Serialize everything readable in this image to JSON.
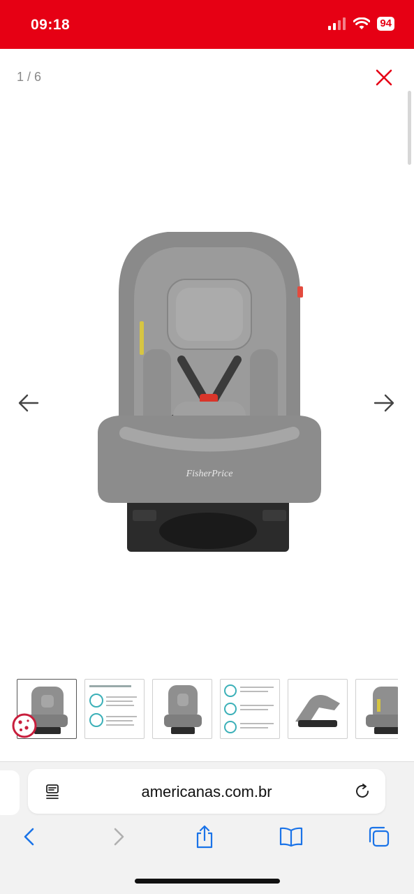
{
  "status_bar": {
    "time": "09:18",
    "battery": "94"
  },
  "viewer": {
    "counter": "1 / 6",
    "brand_text": "FisherPrice",
    "accent_color": "#e60014"
  },
  "thumbnails": [
    {
      "name": "thumb-1",
      "selected": true
    },
    {
      "name": "thumb-2",
      "selected": false
    },
    {
      "name": "thumb-3",
      "selected": false
    },
    {
      "name": "thumb-4",
      "selected": false
    },
    {
      "name": "thumb-5",
      "selected": false
    },
    {
      "name": "thumb-6",
      "selected": false
    }
  ],
  "browser": {
    "url": "americanas.com.br",
    "icons": [
      "reader-icon",
      "reload-icon",
      "back-icon",
      "forward-icon",
      "share-icon",
      "bookmarks-icon",
      "tabs-icon"
    ]
  }
}
